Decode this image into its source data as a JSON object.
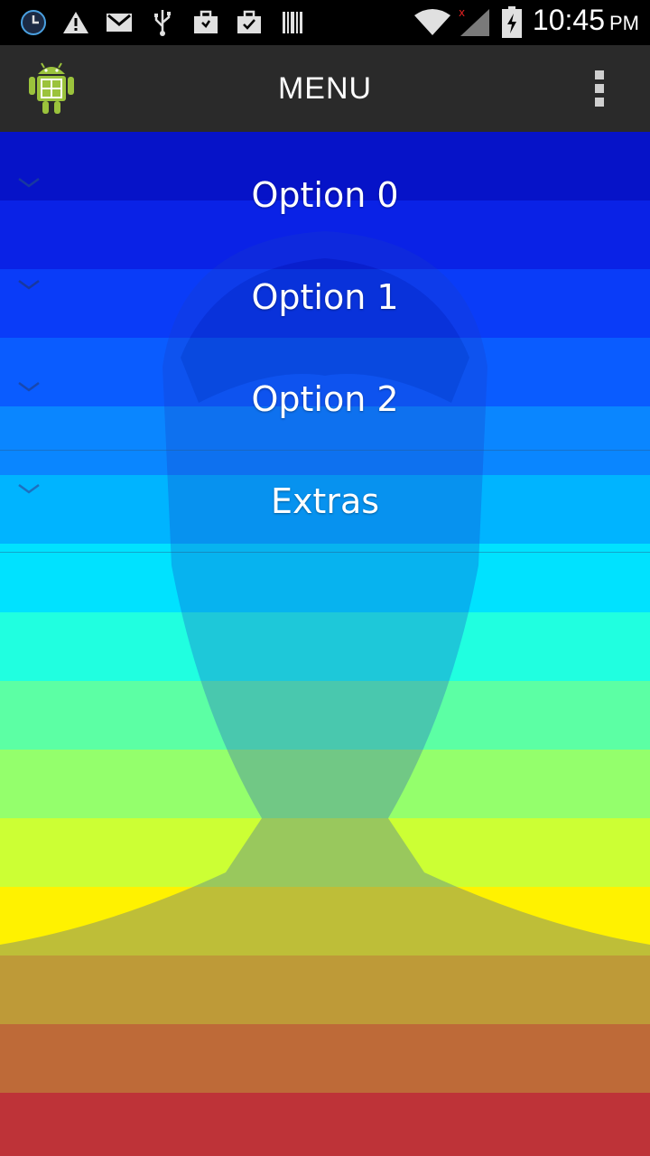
{
  "status_bar": {
    "time": "10:45",
    "ampm": "PM",
    "icons": [
      "clock-app-icon",
      "warning-icon",
      "gmail-icon",
      "usb-icon",
      "briefcase-icon",
      "briefcase-check-icon",
      "barcode-icon",
      "wifi-icon",
      "signal-icon",
      "battery-charging-icon"
    ]
  },
  "action_bar": {
    "title": "MENU",
    "app_icon": "android-calculator-icon",
    "overflow_icon": "overflow-menu-icon"
  },
  "menu": {
    "items": [
      {
        "label": "Option 0"
      },
      {
        "label": "Option 1"
      },
      {
        "label": "Option 2"
      },
      {
        "label": "Extras"
      }
    ]
  },
  "colors": {
    "statusbar_bg": "#000000",
    "actionbar_bg": "#2a2a2a",
    "gradient": [
      "#0a18d6",
      "#0a2ef0",
      "#0a55ff",
      "#0a8cff",
      "#00c6ff",
      "#10f0e8",
      "#3cffb4",
      "#7cff7c",
      "#b4ff46",
      "#e6ff1e",
      "#ffe000",
      "#ffb000",
      "#ff7a00",
      "#ff4a00",
      "#ff1e00"
    ]
  }
}
